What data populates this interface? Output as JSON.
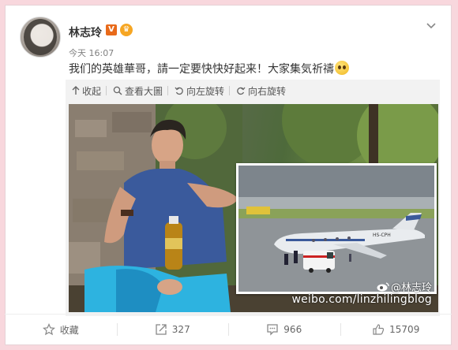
{
  "post": {
    "username": "林志玲",
    "vip_badge": "V",
    "crown_badge": "♛",
    "timestamp": "今天 16:07",
    "text": "我们的英雄華哥，請一定要快快好起来！大家集気祈禱"
  },
  "media_toolbar": {
    "collapse": "收起",
    "view_large": "查看大圖",
    "rotate_left": "向左旋转",
    "rotate_right": "向右旋转"
  },
  "photo": {
    "watermark_handle": "@林志玲",
    "watermark_url": "weibo.com/linzhilingblog",
    "inset_registration": "HS-CPH"
  },
  "actions": {
    "favorite": "收藏",
    "repost_count": "327",
    "comment_count": "966",
    "like_count": "15709"
  },
  "colors": {
    "background": "#f8d7dd",
    "vip_badge": "#e86a1a",
    "crown_badge": "#f6a623"
  },
  "icons": [
    "chevron-down-icon",
    "collapse-arrow-icon",
    "magnify-icon",
    "rotate-left-icon",
    "rotate-right-icon",
    "star-icon",
    "share-icon",
    "comment-icon",
    "thumbs-up-icon",
    "emoji-icon"
  ]
}
